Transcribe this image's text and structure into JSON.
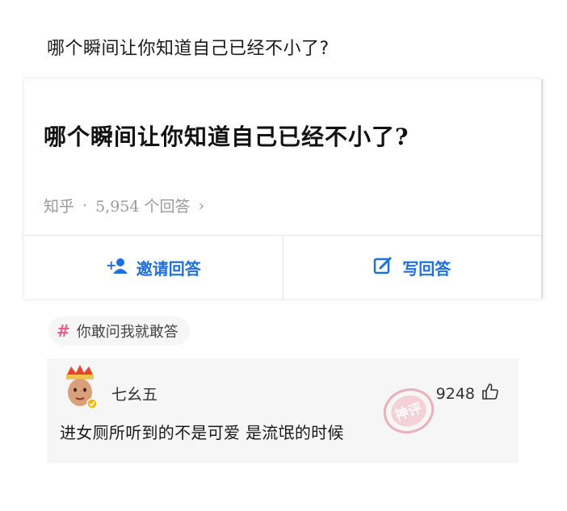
{
  "page": {
    "title": "哪个瞬间让你知道自己已经不小了?"
  },
  "card": {
    "title": "哪个瞬间让你知道自己已经不小了?",
    "source": "知乎",
    "separator": "·",
    "answer_count": "5,954 个回答",
    "chevron": "›",
    "invite_label": "邀请回答",
    "write_label": "写回答",
    "accent": "#1e70e0"
  },
  "tag": {
    "hash": "#",
    "label": "你敢问我就敢答"
  },
  "comment": {
    "username": "七幺五",
    "likes": "9248",
    "text": "进女厕所听到的不是可爱 是流氓的时候",
    "stamp_text": "神评"
  }
}
